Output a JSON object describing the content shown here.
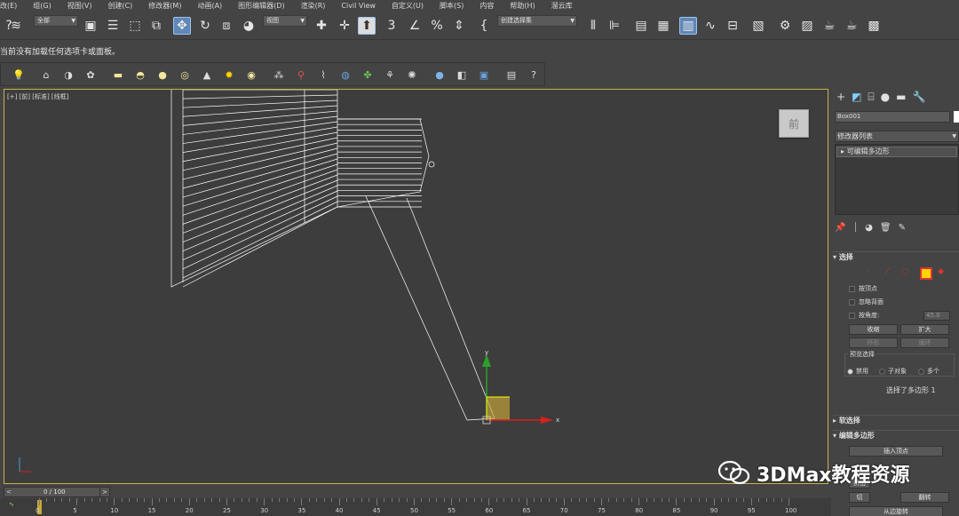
{
  "menu": [
    "改(E)",
    "组(G)",
    "视图(V)",
    "创建(C)",
    "修改器(M)",
    "动画(A)",
    "图形编辑器(D)",
    "渲染(R)",
    "Civil View",
    "自定义(U)",
    "脚本(S)",
    "内容",
    "帮助(H)",
    "溜云库"
  ],
  "toolbar": {
    "filter_value": "全部",
    "coord_value": "视图",
    "named_selection_placeholder": "创建选择集"
  },
  "hint": "当前没有加载任何选项卡或面板。",
  "viewport": {
    "label": "[+] [前] [标准] [线框]",
    "viewcube": "前",
    "axis_x": "x",
    "axis_y": "y"
  },
  "panel": {
    "object_name": "Box001",
    "modifier_list": "修改器列表",
    "stack_item": "可编辑多边形",
    "selection_rollout": "选择",
    "by_vertex": "按顶点",
    "ignore_backfacing": "忽略背面",
    "by_angle": "按角度:",
    "angle_value": "45.0",
    "shrink": "收缩",
    "grow": "扩大",
    "ring": "环形",
    "loop": "循环",
    "preview_group": "预览选择",
    "preview_options": [
      "禁用",
      "子对象",
      "多个"
    ],
    "status": "选择了多边形 1",
    "soft_selection": "软选择",
    "edit_poly": "编辑多边形",
    "insert_vertex": "插入顶点",
    "extrude": "挤出",
    "hinge": "切",
    "flip": "翻转",
    "hinge2": "从边旋转"
  },
  "timeline": {
    "frame_label": "0 / 100",
    "ticks": [
      0,
      5,
      10,
      15,
      20,
      25,
      30,
      35,
      40,
      45,
      50,
      55,
      60,
      65,
      70,
      75,
      80,
      85,
      90,
      95,
      100
    ]
  },
  "watermark": "3DMax教程资源",
  "colors": {
    "background": "#444444",
    "viewport": "#3d3d3d",
    "viewport_border": "#c8b24a",
    "active_button": "#5f87b7",
    "wire": "#ffffff",
    "gizmo_x": "#d8201a",
    "gizmo_y": "#2ca02c",
    "selected_face": "#c9a936"
  }
}
